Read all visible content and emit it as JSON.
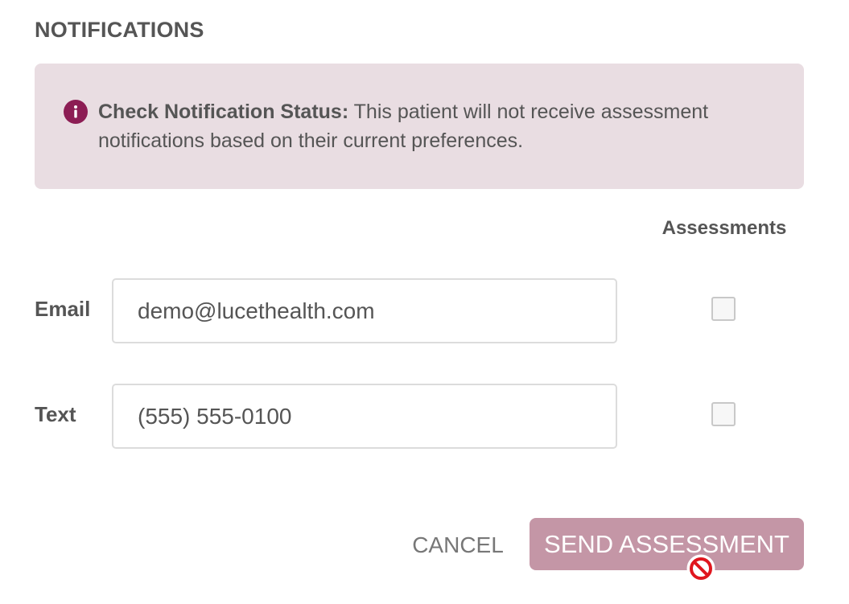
{
  "section": {
    "title": "NOTIFICATIONS"
  },
  "alert": {
    "icon": "info-icon",
    "icon_color": "#8c1d54",
    "background": "#e9dde2",
    "heading": "Check Notification Status:",
    "message": " This patient will not receive assessment notifications based on their current preferences."
  },
  "table": {
    "column_header": "Assessments",
    "rows": [
      {
        "label": "Email",
        "value": "demo@lucethealth.com",
        "assessments_checked": false
      },
      {
        "label": "Text",
        "value": "(555) 555-0100",
        "assessments_checked": false
      }
    ]
  },
  "actions": {
    "cancel_label": "CANCEL",
    "send_label": "SEND ASSESSMENT",
    "send_color": "#c496a6",
    "send_disabled": true
  },
  "cursor": {
    "icon": "not-allowed-icon"
  }
}
